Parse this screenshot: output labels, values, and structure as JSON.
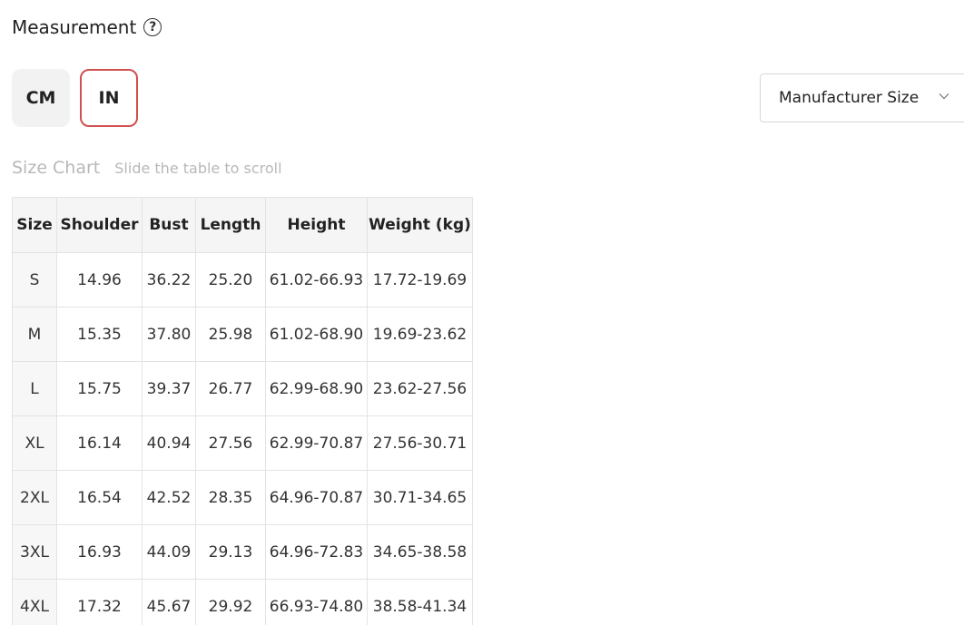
{
  "header": {
    "title": "Measurement",
    "help_icon": "?"
  },
  "units": {
    "cm_label": "CM",
    "in_label": "IN",
    "selected": "IN",
    "selected_border_color": "#d05050"
  },
  "size_select": {
    "value": "Manufacturer Size"
  },
  "chart": {
    "title": "Size Chart",
    "hint": "Slide the table to scroll"
  },
  "table": {
    "columns": [
      "Size",
      "Shoulder",
      "Bust",
      "Length",
      "Height",
      "Weight (kg)"
    ],
    "rows": [
      [
        "S",
        "14.96",
        "36.22",
        "25.20",
        "61.02-66.93",
        "17.72-19.69"
      ],
      [
        "M",
        "15.35",
        "37.80",
        "25.98",
        "61.02-68.90",
        "19.69-23.62"
      ],
      [
        "L",
        "15.75",
        "39.37",
        "26.77",
        "62.99-68.90",
        "23.62-27.56"
      ],
      [
        "XL",
        "16.14",
        "40.94",
        "27.56",
        "62.99-70.87",
        "27.56-30.71"
      ],
      [
        "2XL",
        "16.54",
        "42.52",
        "28.35",
        "64.96-70.87",
        "30.71-34.65"
      ],
      [
        "3XL",
        "16.93",
        "44.09",
        "29.13",
        "64.96-72.83",
        "34.65-38.58"
      ],
      [
        "4XL",
        "17.32",
        "45.67",
        "29.92",
        "66.93-74.80",
        "38.58-41.34"
      ]
    ]
  }
}
